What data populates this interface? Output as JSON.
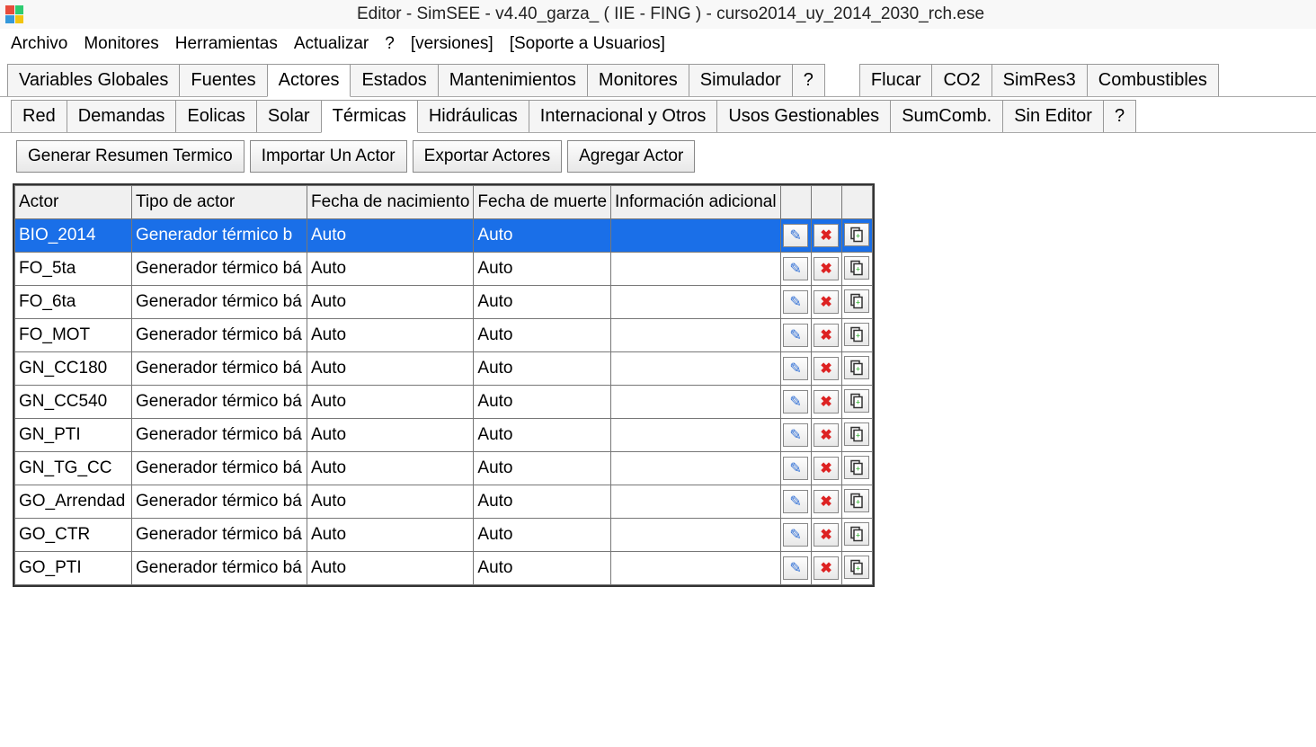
{
  "window": {
    "title": "Editor - SimSEE - v4.40_garza_ ( IIE - FING ) - curso2014_uy_2014_2030_rch.ese"
  },
  "menubar": [
    "Archivo",
    "Monitores",
    "Herramientas",
    "Actualizar",
    "?",
    "[versiones]",
    "[Soporte a Usuarios]"
  ],
  "tabs_main": {
    "items": [
      "Variables Globales",
      "Fuentes",
      "Actores",
      "Estados",
      "Mantenimientos",
      "Monitores",
      "Simulador",
      "?"
    ],
    "items_right": [
      "Flucar",
      "CO2",
      "SimRes3",
      "Combustibles"
    ],
    "active": "Actores"
  },
  "tabs_sub": {
    "items": [
      "Red",
      "Demandas",
      "Eolicas",
      "Solar",
      "Térmicas",
      "Hidráulicas",
      "Internacional y Otros",
      "Usos Gestionables",
      "SumComb.",
      "Sin Editor",
      "?"
    ],
    "active": "Térmicas"
  },
  "buttons": {
    "generar": "Generar Resumen Termico",
    "importar": "Importar Un Actor",
    "exportar": "Exportar Actores",
    "agregar": "Agregar Actor"
  },
  "table": {
    "headers": [
      "Actor",
      "Tipo de actor",
      "Fecha de nacimiento",
      "Fecha de muerte",
      "Información adicional"
    ],
    "rows": [
      {
        "actor": "BIO_2014",
        "tipo": "Generador térmico b",
        "nac": "Auto",
        "mue": "Auto",
        "info": "",
        "selected": true
      },
      {
        "actor": "FO_5ta",
        "tipo": "Generador térmico bá",
        "nac": "Auto",
        "mue": "Auto",
        "info": ""
      },
      {
        "actor": "FO_6ta",
        "tipo": "Generador térmico bá",
        "nac": "Auto",
        "mue": "Auto",
        "info": ""
      },
      {
        "actor": "FO_MOT",
        "tipo": "Generador térmico bá",
        "nac": "Auto",
        "mue": "Auto",
        "info": ""
      },
      {
        "actor": "GN_CC180",
        "tipo": "Generador térmico bá",
        "nac": "Auto",
        "mue": "Auto",
        "info": ""
      },
      {
        "actor": "GN_CC540",
        "tipo": "Generador térmico bá",
        "nac": "Auto",
        "mue": "Auto",
        "info": ""
      },
      {
        "actor": "GN_PTI",
        "tipo": "Generador térmico bá",
        "nac": "Auto",
        "mue": "Auto",
        "info": ""
      },
      {
        "actor": "GN_TG_CC",
        "tipo": "Generador térmico bá",
        "nac": "Auto",
        "mue": "Auto",
        "info": ""
      },
      {
        "actor": "GO_Arrendad",
        "tipo": "Generador térmico bá",
        "nac": "Auto",
        "mue": "Auto",
        "info": ""
      },
      {
        "actor": "GO_CTR",
        "tipo": "Generador térmico bá",
        "nac": "Auto",
        "mue": "Auto",
        "info": ""
      },
      {
        "actor": "GO_PTI",
        "tipo": "Generador térmico bá",
        "nac": "Auto",
        "mue": "Auto",
        "info": ""
      }
    ]
  }
}
